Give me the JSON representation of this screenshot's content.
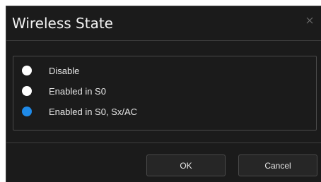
{
  "dialog": {
    "title": "Wireless State",
    "close_icon": "close-icon"
  },
  "options": [
    {
      "label": "Disable",
      "selected": false
    },
    {
      "label": "Enabled in S0",
      "selected": false
    },
    {
      "label": "Enabled in S0, Sx/AC",
      "selected": true
    }
  ],
  "buttons": {
    "ok_label": "OK",
    "cancel_label": "Cancel"
  },
  "colors": {
    "background": "#1b1b1b",
    "accent": "#1f8ae8",
    "text": "#e6e6e6"
  }
}
